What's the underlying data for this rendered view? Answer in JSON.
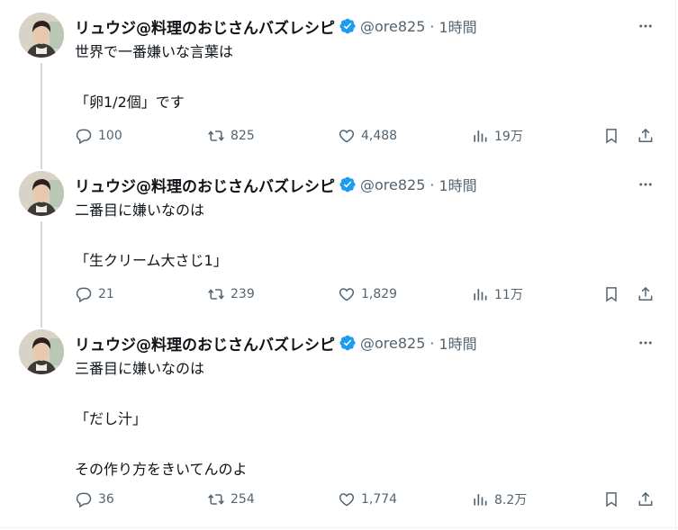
{
  "colors": {
    "text_primary": "#0f1419",
    "text_secondary": "#536471",
    "verified": "#1d9bf0",
    "thread_line": "#cfd9de"
  },
  "tweets": [
    {
      "author_name": "リュウジ@料理のおじさんバズレシピ",
      "handle": "@ore825",
      "separator": "·",
      "time": "1時間",
      "lines": [
        "世界で一番嫌いな言葉は",
        "",
        "「卵1/2個」です"
      ],
      "replies": "100",
      "retweets": "825",
      "likes": "4,488",
      "views": "19万"
    },
    {
      "author_name": "リュウジ@料理のおじさんバズレシピ",
      "handle": "@ore825",
      "separator": "·",
      "time": "1時間",
      "lines": [
        "二番目に嫌いなのは",
        "",
        "「生クリーム大さじ1」"
      ],
      "replies": "21",
      "retweets": "239",
      "likes": "1,829",
      "views": "11万"
    },
    {
      "author_name": "リュウジ@料理のおじさんバズレシピ",
      "handle": "@ore825",
      "separator": "·",
      "time": "1時間",
      "lines": [
        "三番目に嫌いなのは",
        "",
        "「だし汁」",
        "",
        "その作り方をきいてんのよ"
      ],
      "replies": "36",
      "retweets": "254",
      "likes": "1,774",
      "views": "8.2万"
    }
  ],
  "icons": {
    "reply": "reply-icon",
    "retweet": "retweet-icon",
    "like": "heart-icon",
    "views": "views-chart-icon",
    "bookmark": "bookmark-icon",
    "share": "share-icon",
    "more": "more-icon",
    "verified": "verified-badge-icon"
  }
}
